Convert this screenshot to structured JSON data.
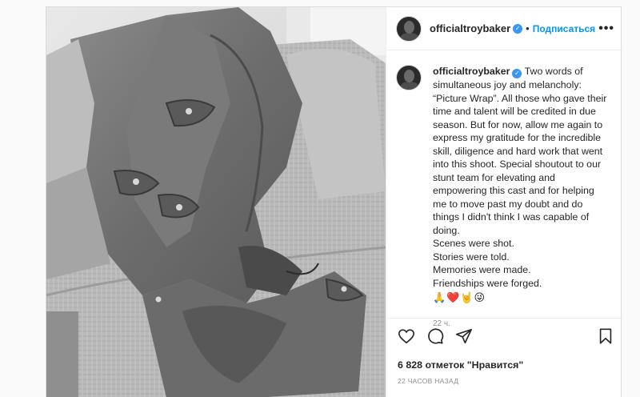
{
  "post": {
    "image_alt": "black and white photo of a jacket on a couch",
    "header": {
      "username": "officialtroybaker",
      "verified_icon": "verified-badge-icon",
      "separator": "•",
      "follow_label": "Подписаться",
      "more_label": "•••"
    },
    "caption": {
      "username": "officialtroybaker",
      "intro": "Two words of simultaneous joy and melancholy: “Picture Wrap”. All those who gave their time and talent will be credited in due season. But for now, allow me again to express my gratitude for the incredible skill, diligence and hard work that went into this shoot. Special shoutout to our stunt team for elevating and empowering this cast and for helping me to move past my doubt and do things I didn't think I was capable of doing.",
      "lines": [
        "Scenes were shot.",
        "Stories were told.",
        "Memories were made.",
        "Friendships were forged."
      ],
      "emojis": "🙏❤️🤘😜",
      "relative_time": "22 ч."
    },
    "actions": {
      "like_icon": "heart-icon",
      "comment_icon": "comment-icon",
      "share_icon": "share-icon",
      "save_icon": "bookmark-icon"
    },
    "likes_text": "6 828 отметок \"Нравится\"",
    "timestamp": "22 ЧАСОВ НАЗАД"
  }
}
